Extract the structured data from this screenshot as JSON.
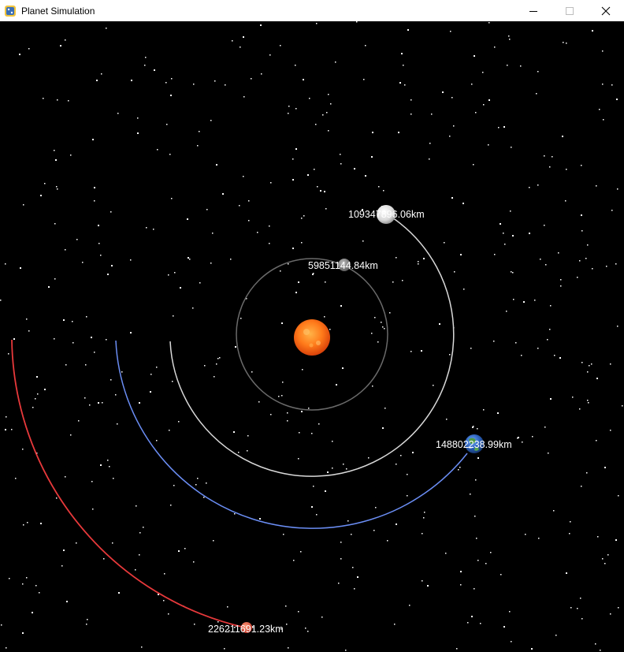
{
  "window": {
    "title": "Planet Simulation",
    "app_icon": "python-icon",
    "controls": {
      "minimize": "minimize-icon",
      "maximize": "maximize-icon",
      "close": "close-icon"
    }
  },
  "colors": {
    "background": "#000000",
    "star": "#ffffff",
    "sun": "#ff7a1a",
    "mercury_orbit": "#6a6a6a",
    "venus_orbit": "#d9d9d9",
    "earth_orbit": "#6b8ef5",
    "mars_orbit": "#e8393b",
    "label": "#ffffff"
  },
  "planets": [
    {
      "id": "mercury",
      "distance_label": "59851144.84km"
    },
    {
      "id": "venus",
      "distance_label": "109347896.06km"
    },
    {
      "id": "earth",
      "distance_label": "148802238.99km"
    },
    {
      "id": "mars",
      "distance_label": "226211691.23km"
    }
  ]
}
